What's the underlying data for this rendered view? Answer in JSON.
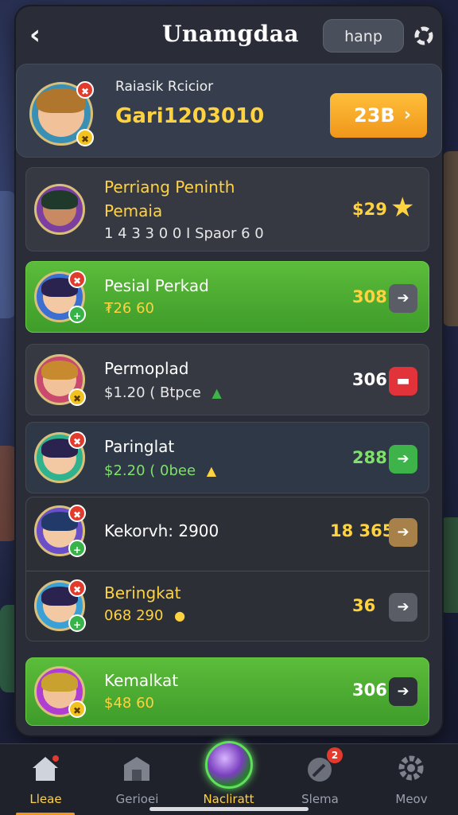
{
  "header": {
    "back_icon": "back-arrow-icon",
    "title": "Unamgdaa",
    "help_label": "hanp",
    "settings_icon": "settings-icon"
  },
  "profile": {
    "name": "Raiasik Rcicior",
    "id": "Gari1203010",
    "button_label": "23B",
    "button_icon": "chevron-right-icon"
  },
  "rows": [
    {
      "name_line1": "Perriang Peninth",
      "name_line2": "Pemaia",
      "sub": "1 4 3  3 0 0  I Spaor  6 0",
      "score": "$29",
      "action_icon": "star-icon",
      "style": "grey"
    },
    {
      "name": "Pesial Perkad",
      "sub": "₮26 60",
      "score": "308",
      "action_icon": "arrow-icon",
      "style": "green"
    },
    {
      "name": "Permoplad",
      "sub": "$1.20 ( Btpce",
      "sub_icon": "up-triangle-icon",
      "score": "306",
      "action_icon": "flag-icon",
      "style": "grey"
    },
    {
      "name": "Paringlat",
      "sub": "$2.20 ( 0bee",
      "sub_icon": "warning-icon",
      "score": "288",
      "action_icon": "arrow-icon",
      "style": "grey"
    },
    {
      "name": "Kekorvh: 2900",
      "score": "18 365a",
      "action_icon": "arrow-icon",
      "style": "dark"
    },
    {
      "name": "Beringkat",
      "sub": "068 290",
      "sub_icon": "warning-icon",
      "score": "36",
      "action_icon": "arrow-icon",
      "style": "dark"
    },
    {
      "name": "Kemalkat",
      "sub": "$48 60",
      "score": "306",
      "action_icon": "arrow-icon",
      "style": "green"
    }
  ],
  "nav": [
    {
      "label": "Lleae",
      "icon": "home-icon",
      "active": true
    },
    {
      "label": "Gerioei",
      "icon": "shop-icon"
    },
    {
      "label": "Nacliratt",
      "icon": "orb-icon"
    },
    {
      "label": "Slema",
      "icon": "compass-icon",
      "badge": "2"
    },
    {
      "label": "Meov",
      "icon": "gear-icon"
    }
  ],
  "colors": {
    "accent_yellow": "#ffd23f",
    "accent_orange": "#f0961a",
    "row_green": "#4fae33",
    "panel": "#2a2d38"
  }
}
